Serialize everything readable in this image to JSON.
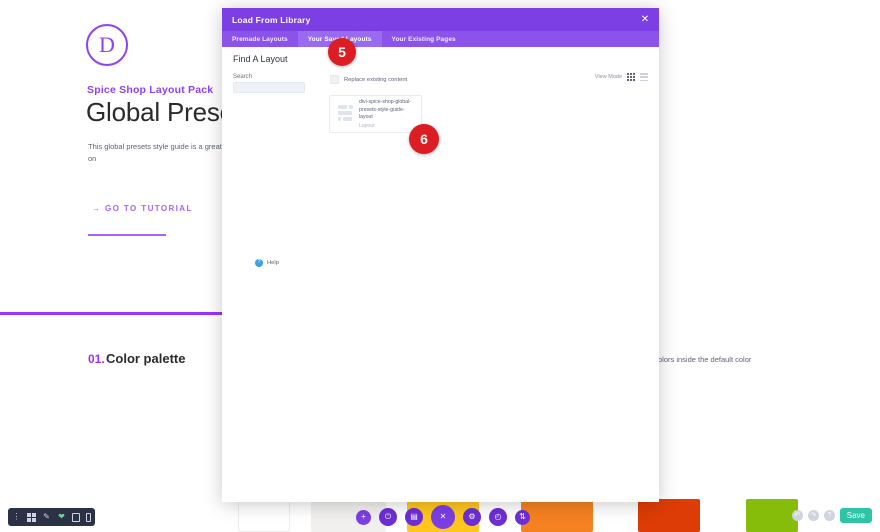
{
  "page": {
    "logo_letter": "D",
    "eyebrow": "Spice Shop Layout Pack",
    "headline": "Global Presets U",
    "body_copy": "This global presets style guide is a great way t into global presets? For a detailed tutorial on",
    "cta_label": "→ GO TO TUTORIAL",
    "section_number": "01.",
    "section_title": "Color palette",
    "section_copy": "olors inside the default color"
  },
  "modal": {
    "title": "Load From Library",
    "close_label": "✕",
    "tabs": [
      {
        "label": "Premade Layouts",
        "active": false
      },
      {
        "label": "Your Saved Layouts",
        "active": true
      },
      {
        "label": "Your Existing Pages",
        "active": false
      }
    ],
    "find_title": "Find A Layout",
    "search_label": "Search",
    "search_value": "",
    "search_placeholder": "",
    "view_mode_label": "View Mode",
    "replace_label": "Replace existing content",
    "layout_card": {
      "name": "divi-spice-shop-global-presets-style-guide-layout",
      "type": "Layout"
    },
    "help_label": "Help",
    "help_icon_glyph": "?"
  },
  "badges": {
    "five": "5",
    "six": "6"
  },
  "toolbar": {
    "mini_icons": [
      "more-vertical-icon",
      "grid-icon",
      "wrench-icon",
      "divi-leaf-icon",
      "desktop-icon",
      "mobile-icon"
    ],
    "fab_icons": [
      "plus-icon",
      "power-icon",
      "save-disk-icon",
      "close-x-icon",
      "settings-gear-icon",
      "history-clock-icon",
      "updown-arrows-icon"
    ],
    "right_dots": [
      "undo-icon",
      "redo-icon",
      "help-icon"
    ],
    "save_label": "Save"
  },
  "colors": {
    "brand_purple": "#7b3fe4",
    "accent_purple": "#9b30ff",
    "badge_red": "#dd1d24",
    "save_teal": "#2ec4a6",
    "swatches": [
      "#ffffff",
      "#f1f0ee",
      "#ffc61e",
      "#f58220",
      "#dd3c06",
      "#86bc0a"
    ]
  }
}
